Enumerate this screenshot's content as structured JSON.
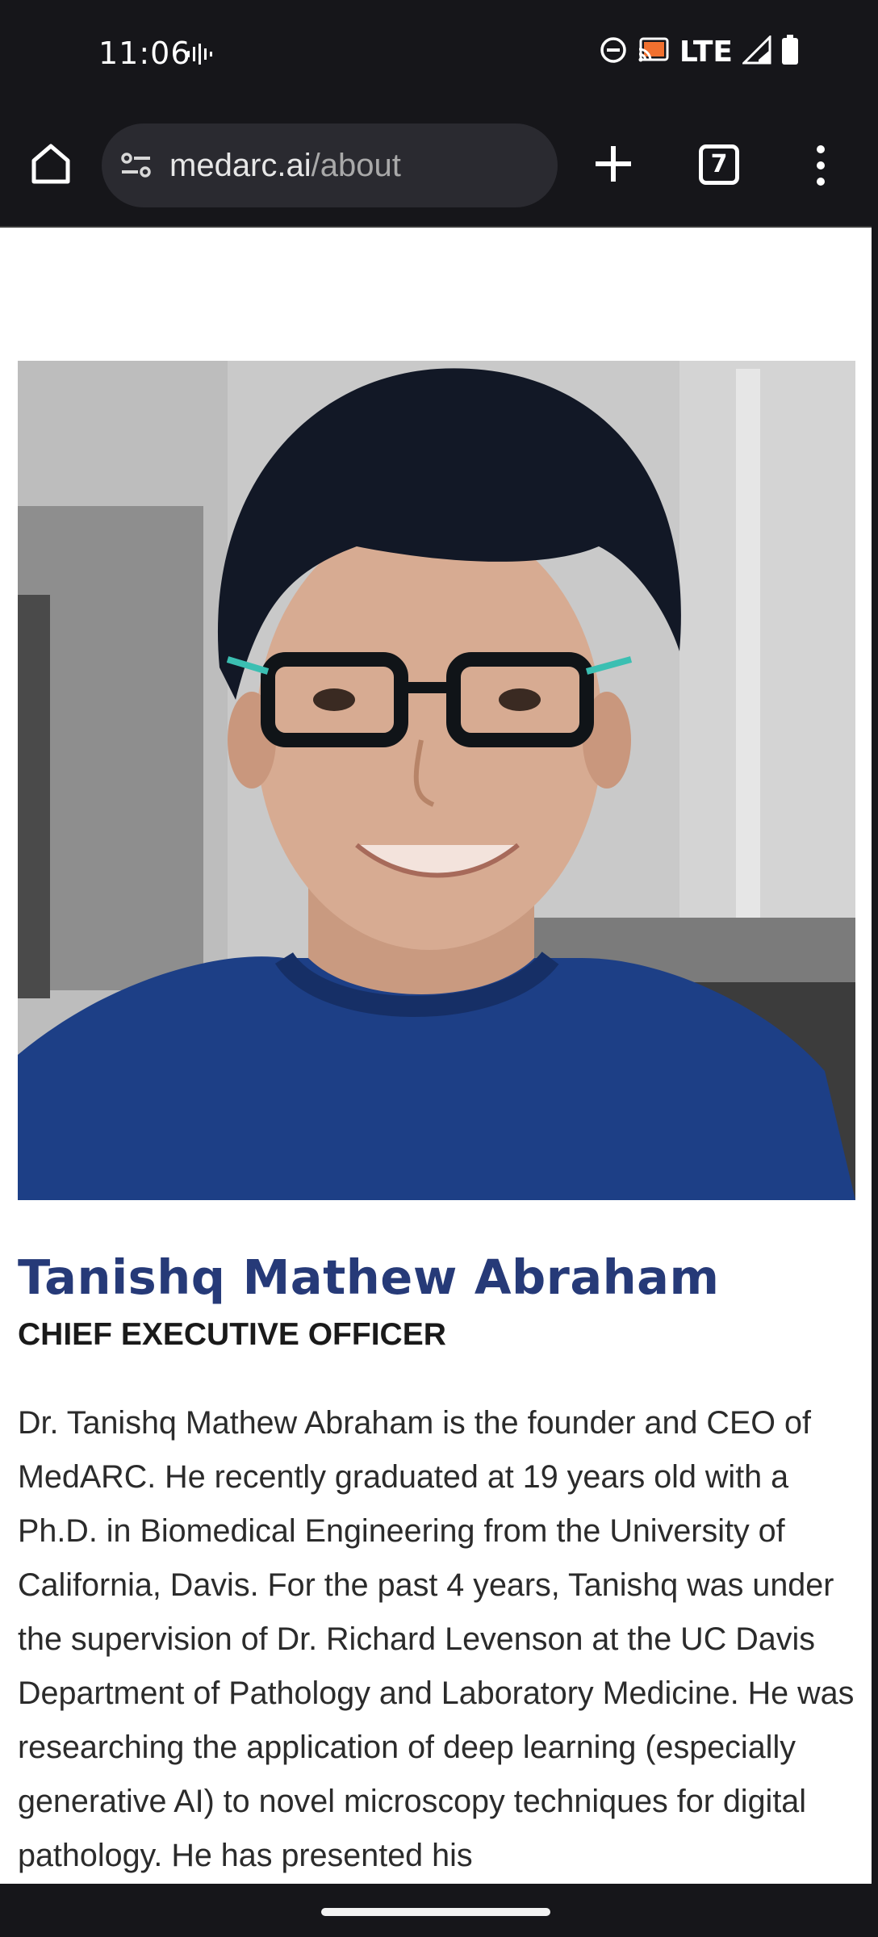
{
  "status_bar": {
    "time": "11:06",
    "network": "LTE",
    "icons": [
      "voice-activity-icon",
      "do-not-disturb-icon",
      "cast-icon",
      "signal-icon",
      "battery-icon"
    ]
  },
  "browser": {
    "url_domain": "medarc.ai",
    "url_path": "/about",
    "tab_count": "7",
    "icons": [
      "home-icon",
      "site-info-icon",
      "plus-icon",
      "tabs-icon",
      "more-vert-icon"
    ]
  },
  "profile": {
    "name": "Tanishq Mathew Abraham",
    "title": "CHIEF EXECUTIVE OFFICER",
    "bio": "Dr. Tanishq Mathew Abraham is the founder and CEO of MedARC. He recently graduated at 19 years old with a Ph.D. in Biomedical Engineering from the University of California, Davis. For the past 4 years, Tanishq was under the supervision of Dr. Richard Levenson at the UC Davis Department of Pathology and Laboratory Medicine. He was researching the application of deep learning (especially generative AI) to novel microscopy techniques for digital pathology. He has presented his"
  },
  "colors": {
    "name_color": "#263a78",
    "chrome_bg": "#16161a",
    "url_bar_bg": "#2a2a30"
  }
}
